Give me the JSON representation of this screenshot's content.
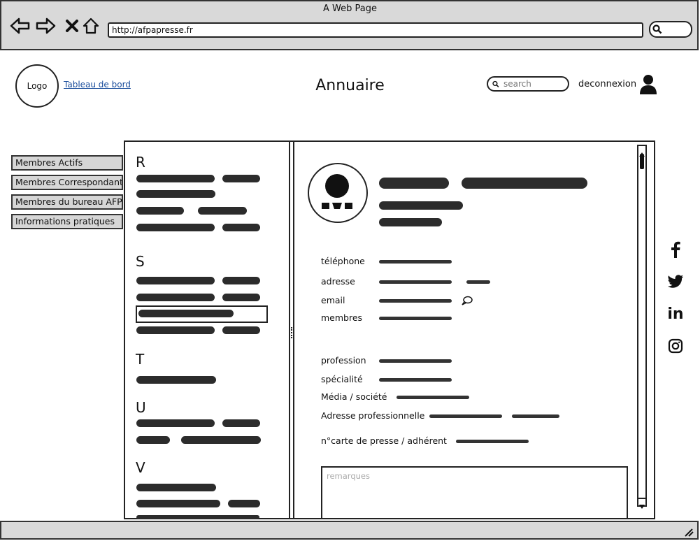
{
  "browser": {
    "window_title": "A Web Page",
    "url": "http://afpapresse.fr"
  },
  "header": {
    "logo": "Logo",
    "dashboard_link": "Tableau de bord",
    "title": "Annuaire",
    "search_placeholder": "search",
    "logout": "deconnexion"
  },
  "menu": {
    "items": [
      {
        "label": "Membres Actifs"
      },
      {
        "label": "Membres Correspondants"
      },
      {
        "label": "Membres du bureau AFPA"
      },
      {
        "label": "Informations pratiques"
      }
    ]
  },
  "directory": {
    "letters": [
      "R",
      "S",
      "T",
      "U",
      "V"
    ]
  },
  "profile": {
    "fields": {
      "phone": "téléphone",
      "address": "adresse",
      "email": "email",
      "members": "membres",
      "profession": "profession",
      "specialty": "spécialité",
      "media": "Média / société",
      "pro_address": "Adresse professionnelle",
      "press_card": "n°carte de presse / adhérent"
    },
    "remarks_placeholder": "remarques"
  },
  "social": {
    "icons": [
      "facebook-icon",
      "twitter-icon",
      "linkedin-icon",
      "instagram-icon"
    ],
    "linkedin_text": "in"
  }
}
